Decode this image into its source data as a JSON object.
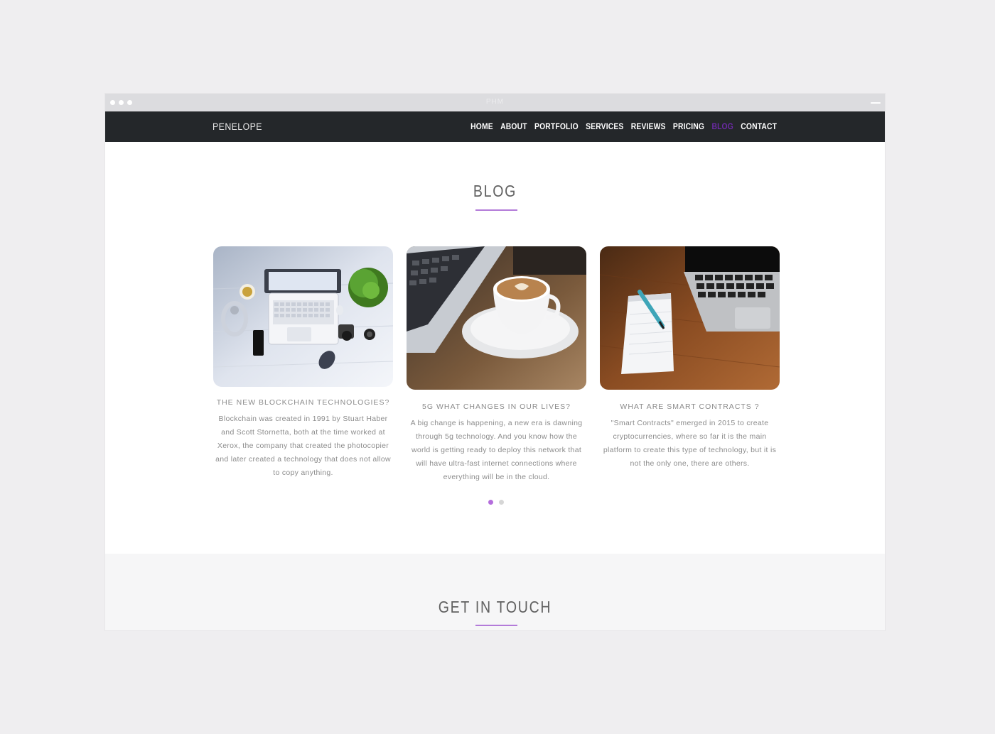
{
  "window": {
    "title": "PHM"
  },
  "navbar": {
    "brand": "PENELOPE",
    "items": [
      {
        "label": "HOME",
        "active": false
      },
      {
        "label": "ABOUT",
        "active": false
      },
      {
        "label": "PORTFOLIO",
        "active": false
      },
      {
        "label": "SERVICES",
        "active": false
      },
      {
        "label": "REVIEWS",
        "active": false
      },
      {
        "label": "PRICING",
        "active": false
      },
      {
        "label": "BLOG",
        "active": true
      },
      {
        "label": "CONTACT",
        "active": false
      }
    ],
    "active_color": "#6d2aa7"
  },
  "blog": {
    "title": "BLOG",
    "accent": "#b37bd9",
    "posts": [
      {
        "image": "laptop-desk-flatlay",
        "title": "THE NEW BLOCKCHAIN TECHNOLOGIES?",
        "text": "Blockchain was created in 1991 by Stuart Haber and Scott Stornetta, both at the time worked at Xerox, the company that created the photocopier and later created a technology that does not allow to copy anything."
      },
      {
        "image": "coffee-cup-laptop",
        "title": "5G WHAT CHANGES IN OUR LIVES?",
        "text": "A big change is happening, a new era is dawning through 5g technology. And you know how the world is getting ready to deploy this network that will have ultra-fast internet connections where everything will be in the cloud."
      },
      {
        "image": "notepad-pen-laptop",
        "title": "WHAT ARE SMART CONTRACTS ?",
        "text": "\"Smart Contracts\" emerged in 2015 to create cryptocurrencies, where so far it is the main platform to create this type of technology, but it is not the only one, there are others."
      }
    ],
    "pager": {
      "pages": 2,
      "current": 1
    }
  },
  "contact": {
    "title": "GET IN TOUCH"
  }
}
